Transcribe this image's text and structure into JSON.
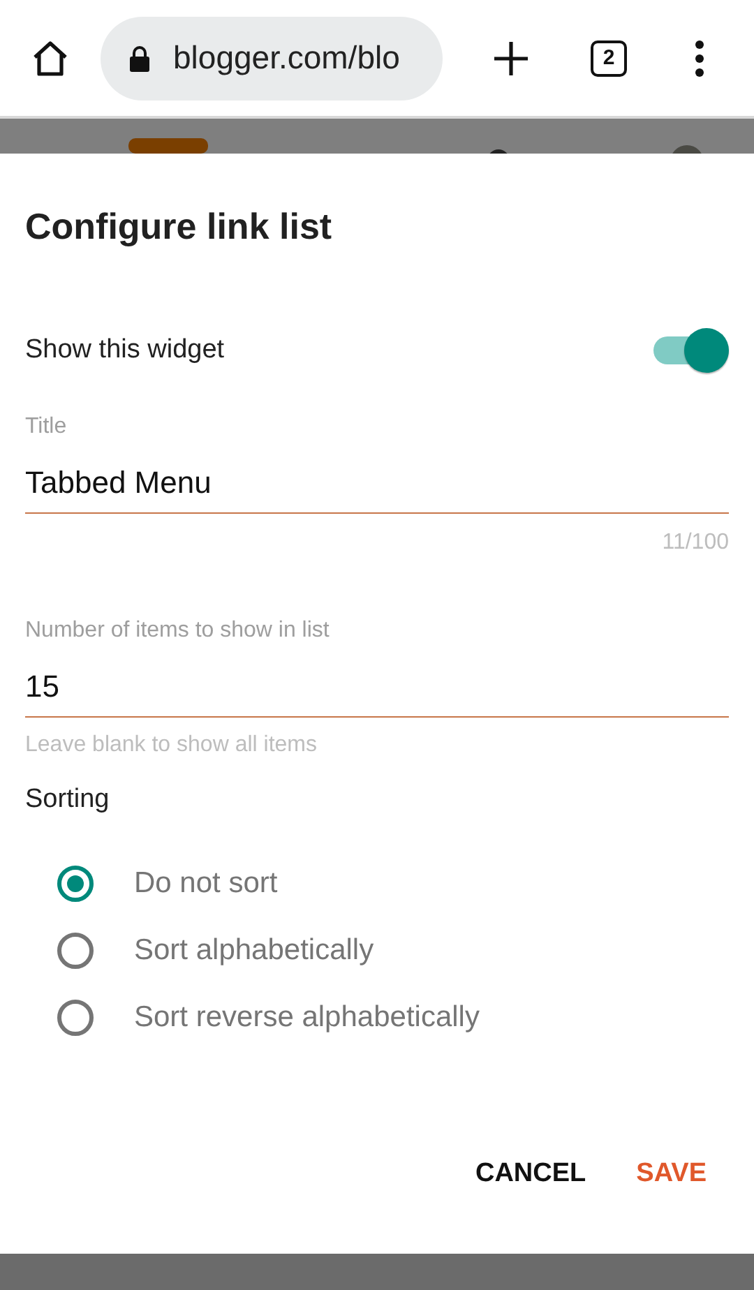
{
  "browser": {
    "url": "blogger.com/blo",
    "tab_count": "2"
  },
  "dialog": {
    "title": "Configure link list",
    "show_widget": {
      "label": "Show this widget",
      "on": true
    },
    "fields": [
      {
        "label": "Title",
        "value": "Tabbed Menu",
        "counter": "11/100"
      },
      {
        "label": "Number of items to show in list",
        "value": "15",
        "helper": "Leave blank to show all items"
      }
    ],
    "sorting": {
      "label": "Sorting",
      "options": [
        {
          "label": "Do not sort",
          "selected": true
        },
        {
          "label": "Sort alphabetically",
          "selected": false
        },
        {
          "label": "Sort reverse alphabetically",
          "selected": false
        }
      ]
    },
    "buttons": [
      {
        "label": "CANCEL",
        "kind": "secondary"
      },
      {
        "label": "SAVE",
        "kind": "primary"
      }
    ]
  }
}
